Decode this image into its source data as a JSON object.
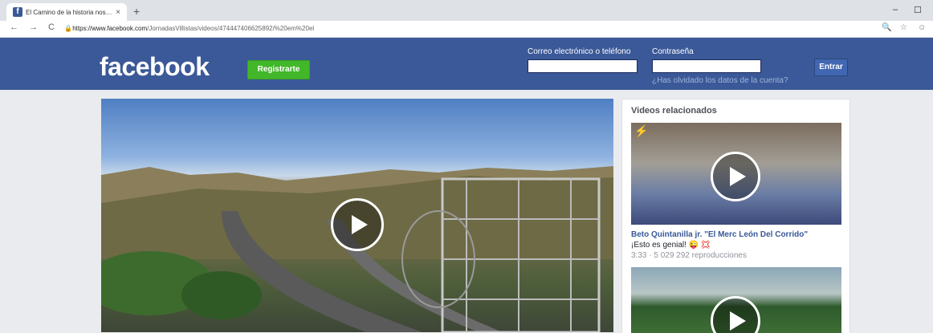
{
  "browser": {
    "tab_title": "El Camino de la historia nos llev...",
    "tab_close": "×",
    "new_tab": "+",
    "url_host": "https://www.facebook.com",
    "url_path": "/JornadasVillistas/videos/474447406625892/%20em%20el",
    "nav_back": "←",
    "nav_forward": "→",
    "nav_reload": "C",
    "lock": "🔒",
    "min": "–",
    "max": "☐",
    "zoom": "🔍",
    "star": "☆",
    "profile": "☺"
  },
  "header": {
    "logo": "facebook",
    "register_label": "Registrarte",
    "email_label": "Correo electrónico o teléfono",
    "password_label": "Contraseña",
    "login_label": "Entrar",
    "forgot_link": "¿Has olvidado los datos de la cuenta?"
  },
  "sidebar": {
    "title": "Videos relacionados",
    "videos": [
      {
        "title": "Beto Quintanilla jr. \"El Merc León Del Corrido\"",
        "subtitle": "¡Esto es genial! 😜 💢",
        "meta": "3:33 · 5 029 292 reproducciones"
      }
    ]
  },
  "colors": {
    "facebook_blue": "#3b5998",
    "register_green": "#42b72a",
    "link_blue": "#385898"
  }
}
